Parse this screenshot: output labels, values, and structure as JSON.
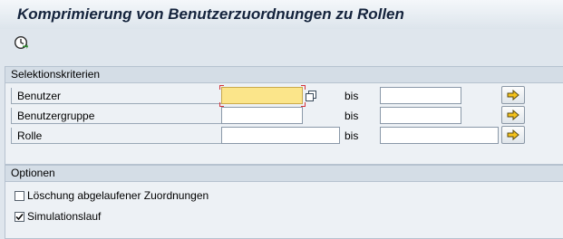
{
  "title": "Komprimierung von Benutzerzuordnungen zu Rollen",
  "toolbar": {
    "execute_icon": "execute-clock-icon"
  },
  "selection": {
    "header": "Selektionskriterien",
    "bis_label": "bis",
    "rows": [
      {
        "label": "Benutzer",
        "from_value": "",
        "to_value": ""
      },
      {
        "label": "Benutzergruppe",
        "from_value": "",
        "to_value": ""
      },
      {
        "label": "Rolle",
        "from_value": "",
        "to_value": ""
      }
    ]
  },
  "options": {
    "header": "Optionen",
    "items": [
      {
        "label": "Löschung abgelaufener Zuordnungen",
        "checked": false
      },
      {
        "label": "Simulationslauf",
        "checked": true
      }
    ]
  },
  "colors": {
    "active_field": "#fbe58a",
    "title_text": "#14233c",
    "arrow_yellow": "#f4c21b"
  }
}
